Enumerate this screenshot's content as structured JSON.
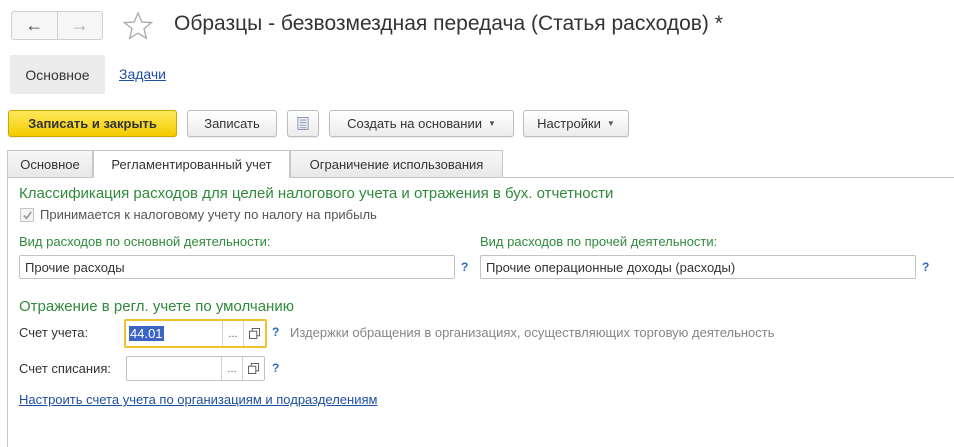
{
  "window": {
    "title": "Образцы - безвозмездная передача (Статья расходов) *",
    "back_icon": "←",
    "forward_icon": "→"
  },
  "sections": {
    "active": "Основное",
    "link": "Задачи"
  },
  "toolbar": {
    "save_close": "Записать и закрыть",
    "save": "Записать",
    "create_based_on": "Создать на основании",
    "settings": "Настройки",
    "dropdown_arrow": "▼"
  },
  "tabs": [
    {
      "label": "Основное",
      "active": false
    },
    {
      "label": "Регламентированный учет",
      "active": true
    },
    {
      "label": "Ограничение использования",
      "active": false
    }
  ],
  "regulated": {
    "group1_title": "Классификация расходов для целей налогового учета и отражения в бух. отчетности",
    "checkbox_label": "Принимается к налоговому учету по налогу на прибыль",
    "checkbox_checked": true,
    "main_activity_label": "Вид расходов по основной деятельности:",
    "main_activity_value": "Прочие расходы",
    "other_activity_label": "Вид расходов по прочей деятельности:",
    "other_activity_value": "Прочие операционные доходы (расходы)",
    "help_mark": "?",
    "group2_title": "Отражение в регл. учете по умолчанию",
    "account_label": "Счет учета:",
    "account_value": "44.01",
    "account_desc": "Издержки обращения в организациях, осуществляющих торговую деятельность",
    "writeoff_label": "Счет списания:",
    "writeoff_value": "",
    "choose_btn": "...",
    "setup_link": "Настроить счета учета по организациям и подразделениям"
  },
  "colors": {
    "accent_green": "#2f8a3b",
    "link_blue": "#1f4fa0",
    "primary_yellow": "#f3cb00",
    "focus_border": "#f2c12e"
  }
}
